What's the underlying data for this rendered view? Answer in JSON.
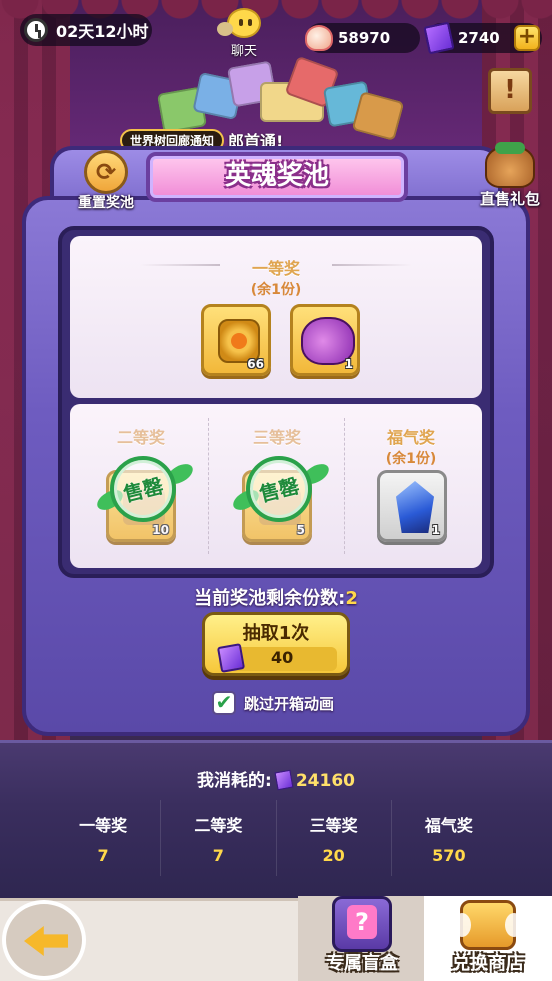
{
  "hud": {
    "timer": "02天12小时",
    "chat_label": "聊天",
    "shell_value": "58970",
    "ticket_value": "2740"
  },
  "announcement": {
    "tag": "世界树回廊通知",
    "message": "郎首通!"
  },
  "side": {
    "reset_label": "重置奖池",
    "gift_label": "直售礼包"
  },
  "pool": {
    "title": "英魂奖池",
    "first": {
      "title": "一等奖",
      "remain": "(余1份)",
      "items": [
        {
          "icon": "coin-medal-icon",
          "count": "66"
        },
        {
          "icon": "purple-pouch-icon",
          "count": "1"
        }
      ]
    },
    "second": {
      "title": "二等奖",
      "count": "10",
      "stamp": "售罄"
    },
    "third": {
      "title": "三等奖",
      "count": "5",
      "stamp": "售罄"
    },
    "lucky": {
      "title": "福气奖",
      "remain": "(余1份)",
      "count": "1",
      "icon": "blue-crystal-icon"
    }
  },
  "remaining": {
    "label": "当前奖池剩余份数:",
    "value": "2"
  },
  "draw": {
    "label": "抽取1次",
    "cost": "40"
  },
  "skip": {
    "label": "跳过开箱动画",
    "checked": true
  },
  "consumed": {
    "label": "我消耗的:",
    "value": "24160"
  },
  "stats": [
    {
      "name": "一等奖",
      "value": "7"
    },
    {
      "name": "二等奖",
      "value": "7"
    },
    {
      "name": "三等奖",
      "value": "20"
    },
    {
      "name": "福气奖",
      "value": "570"
    }
  ],
  "nav": {
    "blind_box": "专属盲盒",
    "shop": "兑换商店"
  },
  "colors": {
    "accent_gold": "#ffd84a",
    "machine_purple": "#6e5cc0",
    "title_pink": "#f08ad6",
    "sold_green": "#2aa14a"
  }
}
